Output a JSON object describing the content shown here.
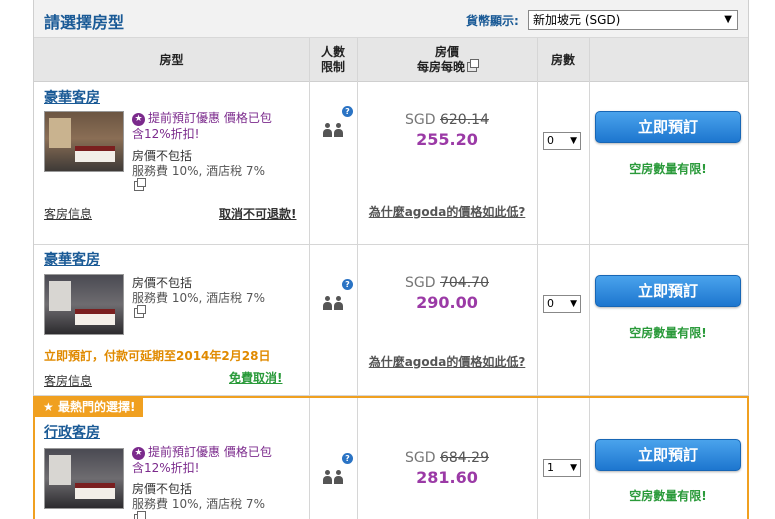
{
  "header": {
    "title": "請選擇房型",
    "currency_label": "貨幣顯示:",
    "currency_value": "新加坡元 (SGD)"
  },
  "columns": {
    "room_type": "房型",
    "occupancy_line1": "人數",
    "occupancy_line2": "限制",
    "price_line1": "房價",
    "price_line2": "每房每晚",
    "rooms": "房數"
  },
  "rooms": [
    {
      "name": "豪華客房",
      "promo": "提前預訂優惠 價格已包含12%折扣!",
      "tax_bold": "房價不包括",
      "tax_detail": "服務費 10%, 酒店稅 7%",
      "room_info": "客房信息",
      "cancel": "取消不可退款!",
      "currency": "SGD",
      "original_price": "620.14",
      "price": "255.20",
      "why": "為什麼agoda的價格如此低?",
      "qty": "0",
      "book": "立即預訂",
      "limited": "空房數量有限!"
    },
    {
      "name": "豪華客房",
      "tax_bold": "房價不包括",
      "tax_detail": "服務費 10%, 酒店稅 7%",
      "pay_later": "立即預訂，付款可延期至2014年2月28日",
      "room_info": "客房信息",
      "cancel": "免費取消!",
      "currency": "SGD",
      "original_price": "704.70",
      "price": "290.00",
      "why": "為什麼agoda的價格如此低?",
      "qty": "0",
      "book": "立即預訂",
      "limited": "空房數量有限!"
    },
    {
      "popular_tag": "最熱門的選擇!",
      "name": "行政客房",
      "promo": "提前預訂優惠 價格已包含12%折扣!",
      "tax_bold": "房價不包括",
      "tax_detail": "服務費 10%, 酒店稅 7%",
      "currency": "SGD",
      "original_price": "684.29",
      "price": "281.60",
      "qty": "1",
      "book": "立即預訂",
      "limited": "空房數量有限!"
    }
  ],
  "colors": {
    "title_blue": "#1a5a96",
    "promo_purple": "#7b2a8c",
    "price_purple": "#9b3aa6",
    "available_green": "#2a9a3a",
    "popular_orange": "#f0a020",
    "button_blue": "#1d76cf"
  },
  "icons": {
    "promo": "star-badge-icon",
    "guest": "two-persons-icon",
    "help": "question-icon",
    "external": "popup-window-icon"
  }
}
